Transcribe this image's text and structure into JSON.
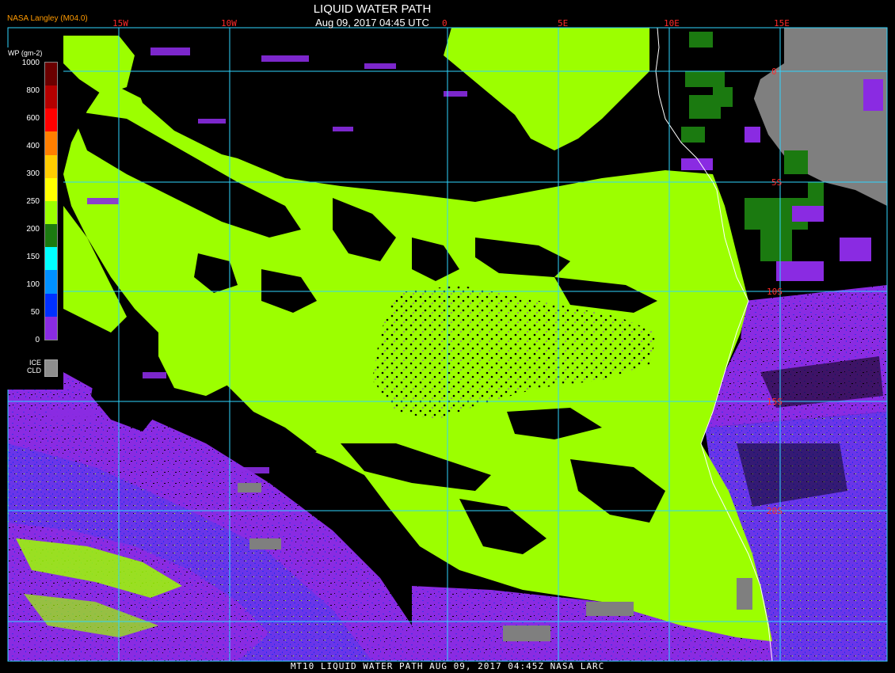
{
  "header": {
    "title": "LIQUID WATER PATH",
    "datetime": "Aug 09, 2017 04:45 UTC",
    "source_tag": "NASA Langley (M04.0)"
  },
  "footer": {
    "caption": "MT10  LIQUID WATER PATH  AUG 09, 2017 04:45Z  NASA LARC"
  },
  "legend": {
    "unit": "WP (gm-2)",
    "ticks": [
      "1000",
      "800",
      "600",
      "400",
      "300",
      "250",
      "200",
      "150",
      "100",
      "50",
      "0"
    ],
    "colors": [
      "#6b0000",
      "#b40000",
      "#ff0000",
      "#ff7f00",
      "#ffcc00",
      "#ffff00",
      "#9cff00",
      "#1b7a10",
      "#00ffff",
      "#0090ff",
      "#0030ff",
      "#8a2be2"
    ],
    "ice_label_line1": "ICE",
    "ice_label_line2": "CLD",
    "ice_color": "#8e8e8e"
  },
  "map": {
    "longitude_labels": [
      "15W",
      "10W",
      "0",
      "5E",
      "10E",
      "15E"
    ],
    "latitude_labels": [
      "0",
      "5S",
      "10S",
      "15S",
      "20S"
    ],
    "grid_color": "#2fd6ff",
    "colors": {
      "cloud_liquid": "#9cff00",
      "thin_cloud": "#8a2be2",
      "thin_cloud_blue": "#3a34e6",
      "clear_ocean": "#000000",
      "land": "#7f7f7f",
      "dark_green": "#1b7a10"
    }
  }
}
